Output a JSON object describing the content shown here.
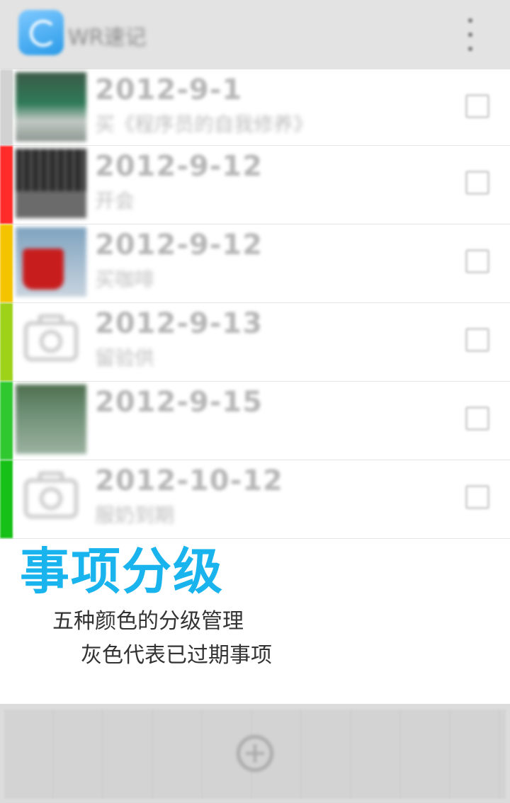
{
  "app_bar": {
    "title": "WR速记",
    "icon": "app-logo-icon",
    "menu_icon": "overflow-menu-icon"
  },
  "items": [
    {
      "date": "2012-9-1",
      "note": "买《程序员的自我修养》",
      "level_color": "#d2d2d2",
      "thumb": "photo-green"
    },
    {
      "date": "2012-9-12",
      "note": "开会",
      "level_color": "#ff2a2a",
      "thumb": "photo-dark"
    },
    {
      "date": "2012-9-12",
      "note": "买咖啡",
      "level_color": "#f5c400",
      "thumb": "photo-cup"
    },
    {
      "date": "2012-9-13",
      "note": "留验供",
      "level_color": "#9ed218",
      "thumb": "camera"
    },
    {
      "date": "2012-9-15",
      "note": "",
      "level_color": "#2fc82f",
      "thumb": "photo-grass"
    },
    {
      "date": "2012-10-12",
      "note": "服奶到期",
      "level_color": "#16c016",
      "thumb": "camera"
    }
  ],
  "feature": {
    "title": "事项分级",
    "line1": "五种颜色的分级管理",
    "line2": "灰色代表已过期事项",
    "title_color": "#19b4ee"
  },
  "bottom_bar": {
    "add_icon": "add-circle-icon"
  }
}
